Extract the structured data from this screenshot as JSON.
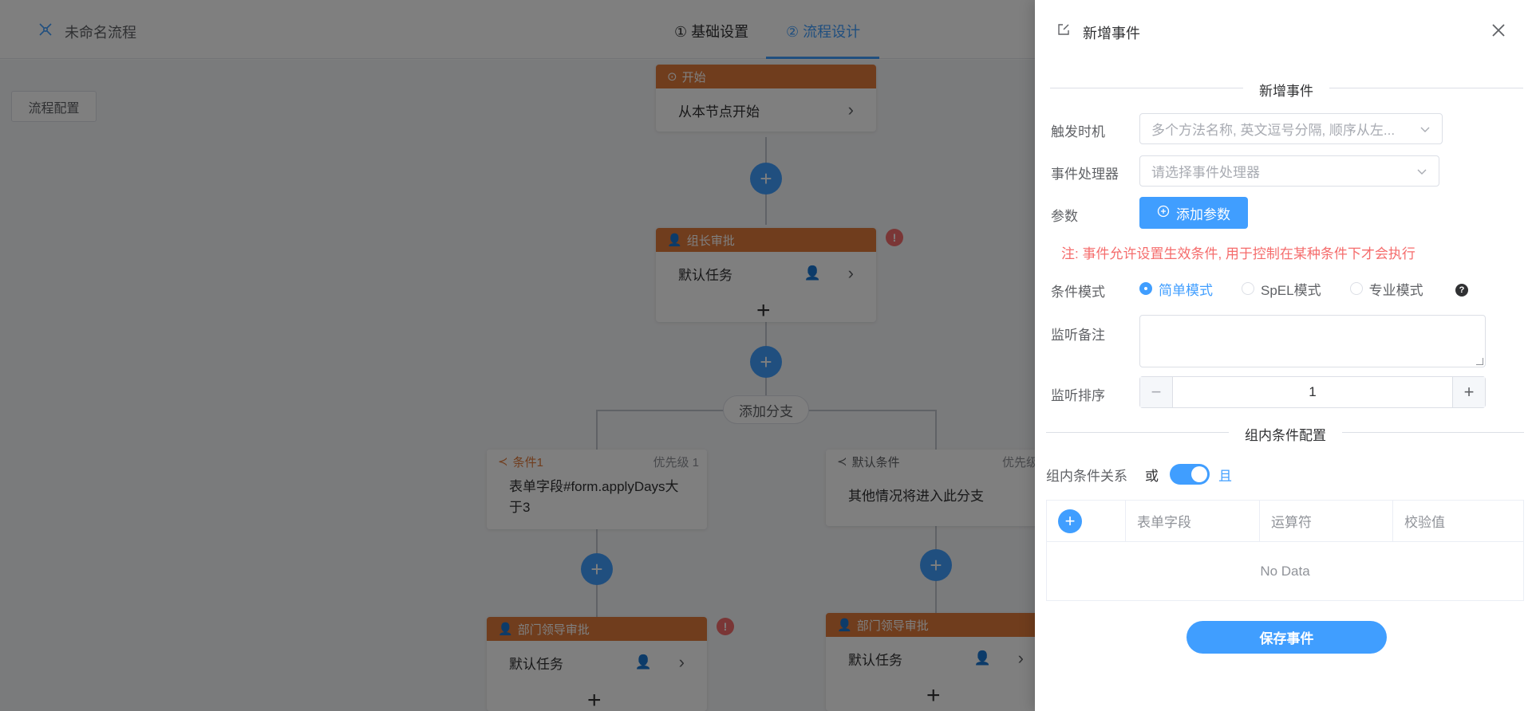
{
  "app": {
    "title": "未命名流程",
    "steps": [
      "① 基础设置",
      "② 流程设计"
    ],
    "config_button": "流程配置"
  },
  "canvas": {
    "start_node": {
      "header": "开始",
      "body": "从本节点开始"
    },
    "leader_node": {
      "header": "组长审批",
      "body": "默认任务"
    },
    "add_branch": "添加分支",
    "branch1": {
      "title": "条件1",
      "priority": "优先级 1",
      "body": "表单字段#form.applyDays大于3"
    },
    "branch2": {
      "title": "默认条件",
      "priority": "优先级",
      "body": "其他情况将进入此分支"
    },
    "dept_node_1": {
      "header": "部门领导审批",
      "body": "默认任务"
    },
    "dept_node_2": {
      "header": "部门领导审批",
      "body": "默认任务"
    }
  },
  "drawer": {
    "title": "新增事件",
    "section_title": "新增事件",
    "trigger": {
      "label": "触发时机",
      "placeholder": "多个方法名称, 英文逗号分隔, 顺序从左..."
    },
    "handler": {
      "label": "事件处理器",
      "placeholder": "请选择事件处理器"
    },
    "params": {
      "label": "参数",
      "button": "添加参数"
    },
    "note": "注: 事件允许设置生效条件, 用于控制在某种条件下才会执行",
    "condition_mode": {
      "label": "条件模式",
      "options": [
        "简单模式",
        "SpEL模式",
        "专业模式"
      ],
      "selected": "简单模式"
    },
    "listen_note": {
      "label": "监听备注",
      "value": ""
    },
    "listen_order": {
      "label": "监听排序",
      "value": "1"
    },
    "group_section_title": "组内条件配置",
    "group_relation": {
      "label": "组内条件关系",
      "off_label": "或",
      "on_label": "且",
      "on": true
    },
    "table": {
      "columns": [
        "表单字段",
        "运算符",
        "校验值"
      ],
      "empty_text": "No Data"
    },
    "save_button": "保存事件"
  },
  "colors": {
    "primary": "#409eff",
    "danger": "#f56c6c",
    "node_orange": "#e07a3b"
  }
}
